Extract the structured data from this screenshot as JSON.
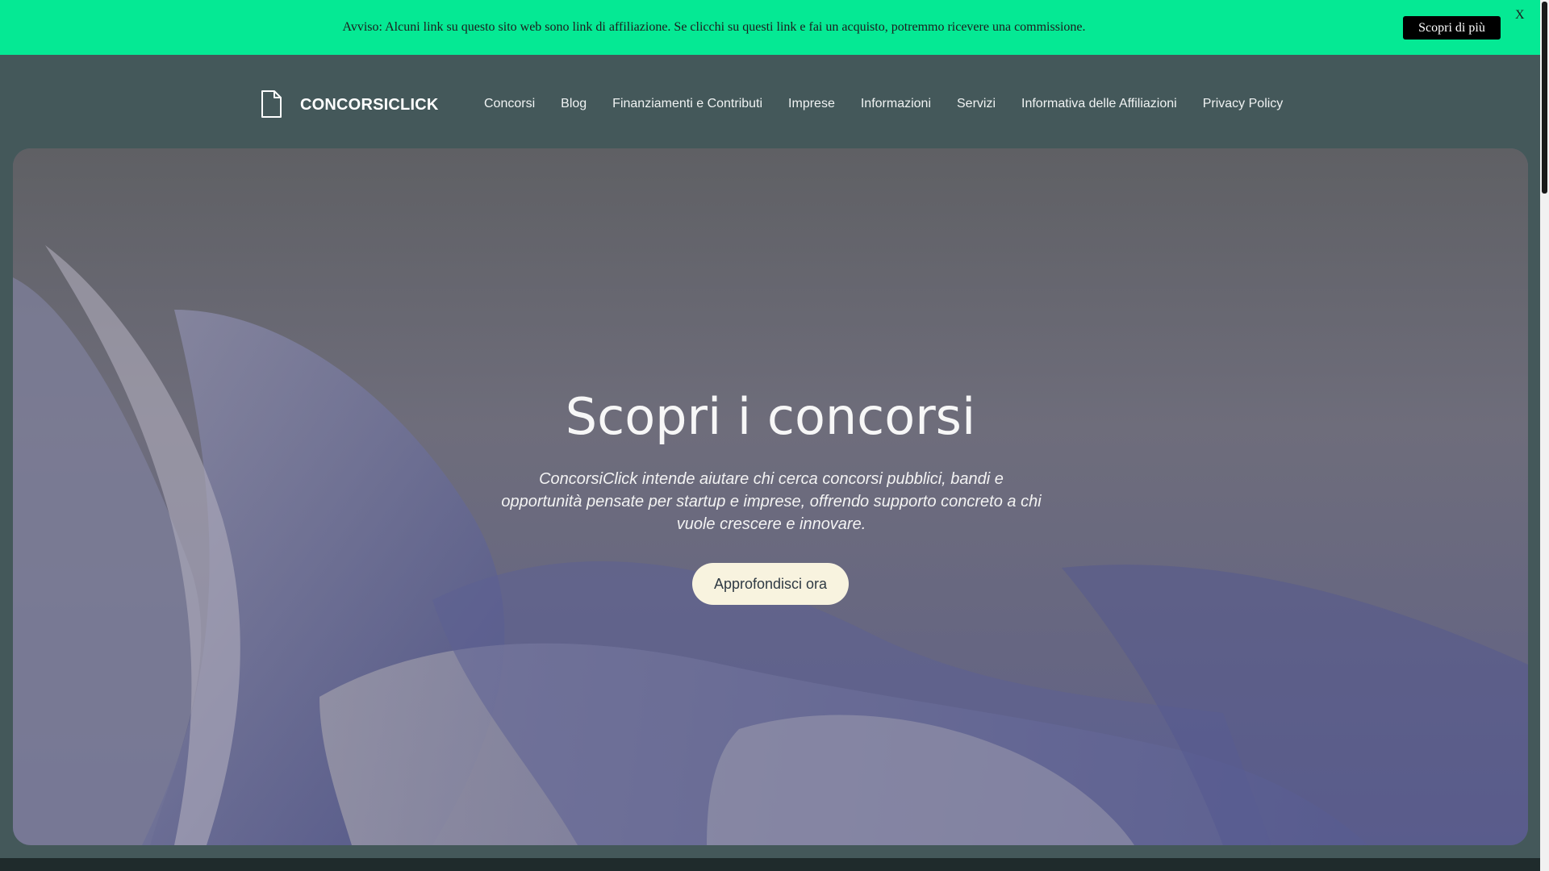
{
  "notice": {
    "text": "Avviso: Alcuni link su questo sito web sono link di affiliazione. Se clicchi su questi link e fai un acquisto, potremmo ricevere una commissione.",
    "button_label": "Scopri di più",
    "close_label": "X"
  },
  "header": {
    "logo_icon": "document-icon",
    "site_name": "CONCORSICLICK",
    "nav": [
      "Concorsi",
      "Blog",
      "Finanziamenti e Contributi",
      "Imprese",
      "Informazioni",
      "Servizi",
      "Informativa delle Affiliazioni",
      "Privacy Policy"
    ]
  },
  "hero": {
    "title": "Scopri i concorsi",
    "subtitle": "ConcorsiClick intende aiutare chi cerca concorsi pubblici, bandi e opportunità pensate per startup e imprese, offrendo supporto concreto a chi vuole crescere e innovare.",
    "button_label": "Approfondisci ora"
  },
  "colors": {
    "notice_bg": "#05e994",
    "page_bg": "#44585a",
    "hero_button_bg": "#f8f3df"
  }
}
